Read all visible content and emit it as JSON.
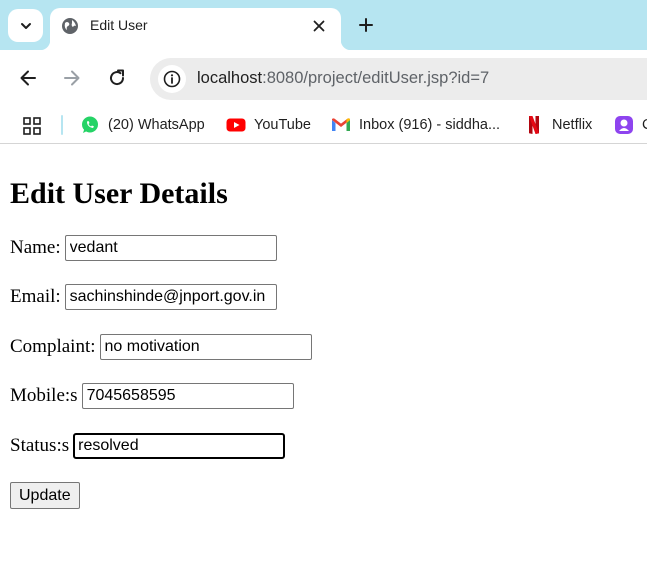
{
  "browser": {
    "tab": {
      "title": "Edit User"
    },
    "address_bar": {
      "host": "localhost",
      "path": ":8080/project/editUser.jsp?id=7"
    },
    "bookmarks": [
      {
        "label": "(20) WhatsApp",
        "icon": "whatsapp-icon"
      },
      {
        "label": "YouTube",
        "icon": "youtube-icon"
      },
      {
        "label": "Inbox (916) - siddha...",
        "icon": "gmail-icon"
      },
      {
        "label": "Netflix",
        "icon": "netflix-icon"
      },
      {
        "label": "C",
        "icon": "app-icon"
      }
    ]
  },
  "page": {
    "heading": "Edit User Details",
    "form": {
      "name_label": "Name:",
      "name_value": "vedant",
      "email_label": "Email:",
      "email_value": "sachinshinde@jnport.gov.in",
      "complaint_label": "Complaint:",
      "complaint_value": "no motivation",
      "mobile_label": "Mobile:s",
      "mobile_value": "7045658595",
      "status_label": "Status:s",
      "status_value": "resolved",
      "submit_label": "Update"
    }
  },
  "colors": {
    "tabstrip": "#b6e5f1",
    "omnibox": "#ececec",
    "whatsapp": "#25d366",
    "youtube": "#ff0000",
    "netflix": "#e50914"
  }
}
